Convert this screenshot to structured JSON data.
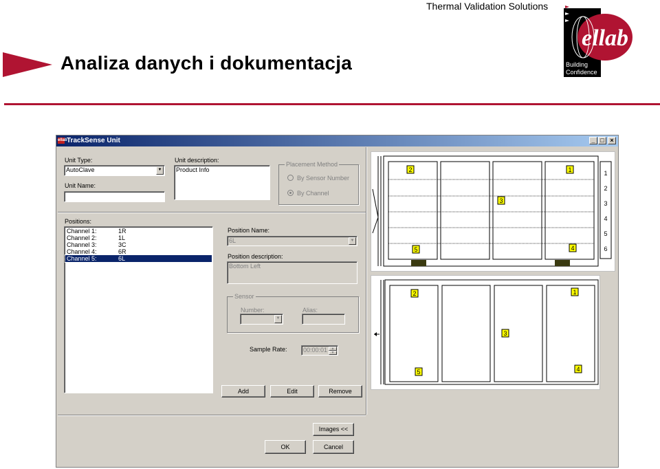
{
  "slide": {
    "title": "Analiza danych i dokumentacja",
    "company": "Thermal Validation Solutions",
    "logo": {
      "brand": "ellab",
      "tagline_1": "Building",
      "tagline_2": "Confidence"
    }
  },
  "window": {
    "title": "TrackSense Unit",
    "app_icon": "ellab-app-icon",
    "controls": {
      "minimize": "_",
      "maximize": "□",
      "close": "×"
    }
  },
  "unit": {
    "type_label": "Unit Type:",
    "type_value": "AutoClave",
    "name_label": "Unit Name:",
    "name_value": "",
    "description_label": "Unit description:",
    "description_value": "Product Info"
  },
  "placement": {
    "caption": "Placement Method",
    "by_sensor": "By Sensor Number",
    "by_channel": "By Channel",
    "selected": "By Channel"
  },
  "positions": {
    "label": "Positions:",
    "rows": [
      {
        "channel": "Channel 1:",
        "position": "1R"
      },
      {
        "channel": "Channel 2:",
        "position": "1L"
      },
      {
        "channel": "Channel 3:",
        "position": "3C"
      },
      {
        "channel": "Channel 4:",
        "position": "6R"
      },
      {
        "channel": "Channel 5:",
        "position": "6L"
      }
    ],
    "selected_index": 4
  },
  "position_detail": {
    "name_label": "Position Name:",
    "name_value": "6L",
    "description_label": "Position description:",
    "description_value": "Bottom Left"
  },
  "sensor": {
    "caption": "Sensor",
    "number_label": "Number:",
    "number_value": "",
    "alias_label": "Alias:",
    "alias_value": ""
  },
  "sample_rate": {
    "label": "Sample Rate:",
    "value": "00:00:01"
  },
  "buttons": {
    "add": "Add",
    "edit": "Edit",
    "remove": "Remove",
    "images": "Images <<",
    "ok": "OK",
    "cancel": "Cancel"
  },
  "diagram_top": {
    "markers": [
      "2",
      "1",
      "3",
      "5",
      "4"
    ],
    "side_numbers": [
      "1",
      "2",
      "3",
      "4",
      "5",
      "6"
    ]
  },
  "diagram_bottom": {
    "markers": [
      "2",
      "1",
      "3",
      "5",
      "4"
    ]
  },
  "colors": {
    "accent": "#b01432",
    "titlebar_start": "#0a246a",
    "titlebar_end": "#a6caf0",
    "dialog_face": "#d4d0c8",
    "marker_fill": "#ffff00",
    "rail_fill": "#3a3a10"
  }
}
